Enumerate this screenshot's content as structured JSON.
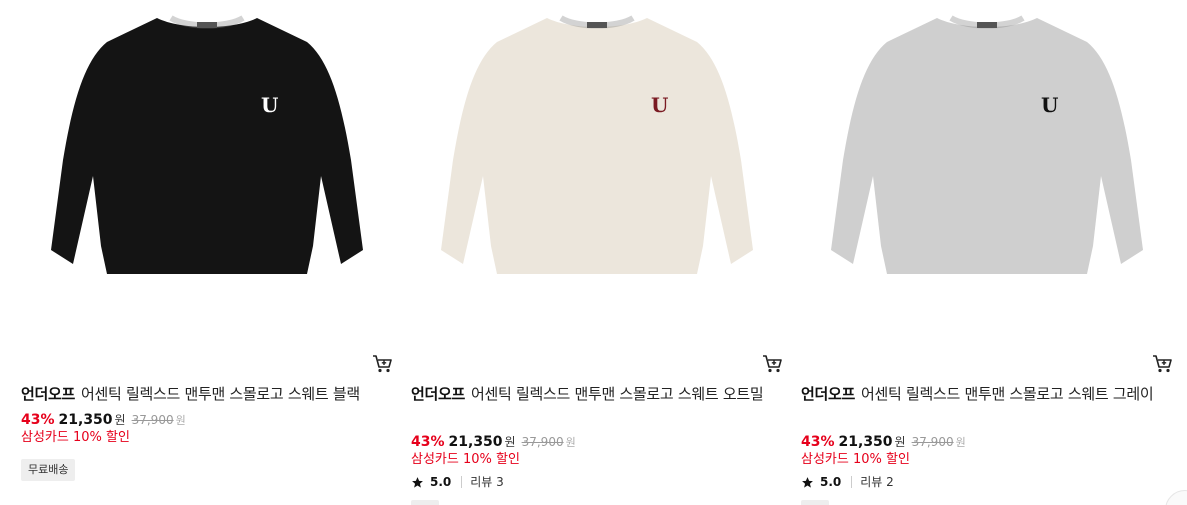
{
  "products": [
    {
      "brand": "언더오프",
      "name": "어센틱 릴렉스드 맨투맨 스몰로고 스웨트 블랙",
      "discount": "43%",
      "sale_price": "21,350",
      "currency": "원",
      "original_price": "37,900",
      "promo": "삼성카드 10% 할인",
      "badge": "무료배송",
      "sweater_color": "#141414",
      "logo_color": "#ffffff",
      "logo_letter": "U",
      "icons": {
        "cart": "cart-icon",
        "star": "star-icon"
      }
    },
    {
      "brand": "언더오프",
      "name": "어센틱 릴렉스드 맨투맨 스몰로고 스웨트 오트밀",
      "discount": "43%",
      "sale_price": "21,350",
      "currency": "원",
      "original_price": "37,900",
      "promo": "삼성카드 10% 할인",
      "rating": "5.0",
      "review_label": "리뷰 3",
      "sweater_color": "#ece6dc",
      "logo_color": "#7a1a22",
      "logo_letter": "U",
      "icons": {
        "cart": "cart-icon",
        "star": "star-icon"
      }
    },
    {
      "brand": "언더오프",
      "name": "어센틱 릴렉스드 맨투맨 스몰로고 스웨트 그레이",
      "discount": "43%",
      "sale_price": "21,350",
      "currency": "원",
      "original_price": "37,900",
      "promo": "삼성카드 10% 할인",
      "rating": "5.0",
      "review_label": "리뷰 2",
      "sweater_color": "#cfcfcf",
      "logo_color": "#111111",
      "logo_letter": "U",
      "icons": {
        "cart": "cart-icon",
        "star": "star-icon"
      }
    }
  ],
  "colors": {
    "discount": "#e6001b",
    "promo": "#e6001b",
    "strike": "#999999"
  }
}
